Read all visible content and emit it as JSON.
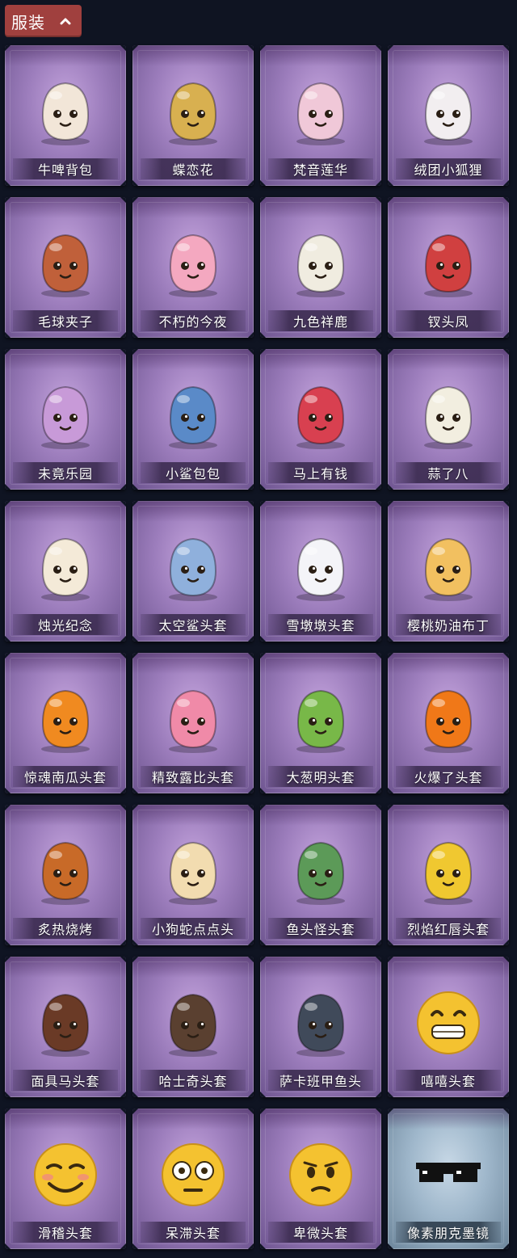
{
  "header": {
    "label": "服装",
    "toggle_icon": "chevron-up-icon",
    "bg_color": "#a0403e"
  },
  "items": [
    {
      "name": "牛啤背包",
      "icon": "cow-beer-barrel-icon",
      "color": "#f2e6d8"
    },
    {
      "name": "蝶恋花",
      "icon": "butterfly-bell-icon",
      "color": "#d8b050"
    },
    {
      "name": "梵音莲华",
      "icon": "lotus-fairy-icon",
      "color": "#f0c8d8"
    },
    {
      "name": "绒团小狐狸",
      "icon": "fox-icon",
      "color": "#f2eef0"
    },
    {
      "name": "毛球夹子",
      "icon": "raccoon-drummer-icon",
      "color": "#c0603a"
    },
    {
      "name": "不朽的今夜",
      "icon": "pink-cat-cake-icon",
      "color": "#f4a8c0"
    },
    {
      "name": "九色祥鹿",
      "icon": "deer-icon",
      "color": "#f0ece0"
    },
    {
      "name": "钗头凤",
      "icon": "phoenix-crown-girl-icon",
      "color": "#d04040"
    },
    {
      "name": "未竟乐园",
      "icon": "jester-girl-icon",
      "color": "#c89ad8"
    },
    {
      "name": "小鲨包包",
      "icon": "shark-bag-icon",
      "color": "#5a8ac8"
    },
    {
      "name": "马上有钱",
      "icon": "red-horse-icon",
      "color": "#d84050"
    },
    {
      "name": "蒜了八",
      "icon": "garlic-icon",
      "color": "#f2eee0"
    },
    {
      "name": "烛光纪念",
      "icon": "candle-icon",
      "color": "#f4ead8"
    },
    {
      "name": "太空鲨头套",
      "icon": "space-shark-helmet-icon",
      "color": "#8fb0dc"
    },
    {
      "name": "雪墩墩头套",
      "icon": "snowman-helmet-icon",
      "color": "#f4f4f8"
    },
    {
      "name": "樱桃奶油布丁",
      "icon": "pudding-icon",
      "color": "#f2c060"
    },
    {
      "name": "惊魂南瓜头套",
      "icon": "pumpkin-icon",
      "color": "#f08a20"
    },
    {
      "name": "精致露比头套",
      "icon": "pink-beaver-icon",
      "color": "#f08aa8"
    },
    {
      "name": "大葱明头套",
      "icon": "green-onion-icon",
      "color": "#78b848"
    },
    {
      "name": "火爆了头套",
      "icon": "fire-face-icon",
      "color": "#f07818"
    },
    {
      "name": "炙热烧烤",
      "icon": "bbq-meat-icon",
      "color": "#c86a28"
    },
    {
      "name": "小狗蛇点点头",
      "icon": "dog-snake-icon",
      "color": "#f2dcb0"
    },
    {
      "name": "鱼头怪头套",
      "icon": "fish-head-icon",
      "color": "#5c9a58"
    },
    {
      "name": "烈焰红唇头套",
      "icon": "yellow-mask-sunglasses-icon",
      "color": "#f0c830"
    },
    {
      "name": "面具马头套",
      "icon": "horse-mask-icon",
      "color": "#6a3a26"
    },
    {
      "name": "哈士奇头套",
      "icon": "husky-sunglasses-icon",
      "color": "#5a4030"
    },
    {
      "name": "萨卡班甲鱼头",
      "icon": "sacabambaspis-icon",
      "color": "#404a5a"
    },
    {
      "name": "嘻嘻头套",
      "icon": "grin-emoji-icon",
      "color": "#f4c230"
    },
    {
      "name": "滑稽头套",
      "icon": "funny-emoji-icon",
      "color": "#f4c230"
    },
    {
      "name": "呆滞头套",
      "icon": "dazed-emoji-icon",
      "color": "#f4c230"
    },
    {
      "name": "卑微头套",
      "icon": "humble-emoji-icon",
      "color": "#f4c230"
    },
    {
      "name": "像素朋克墨镜",
      "icon": "pixel-sunglasses-icon",
      "color": "#111111",
      "theme": "blue"
    }
  ]
}
